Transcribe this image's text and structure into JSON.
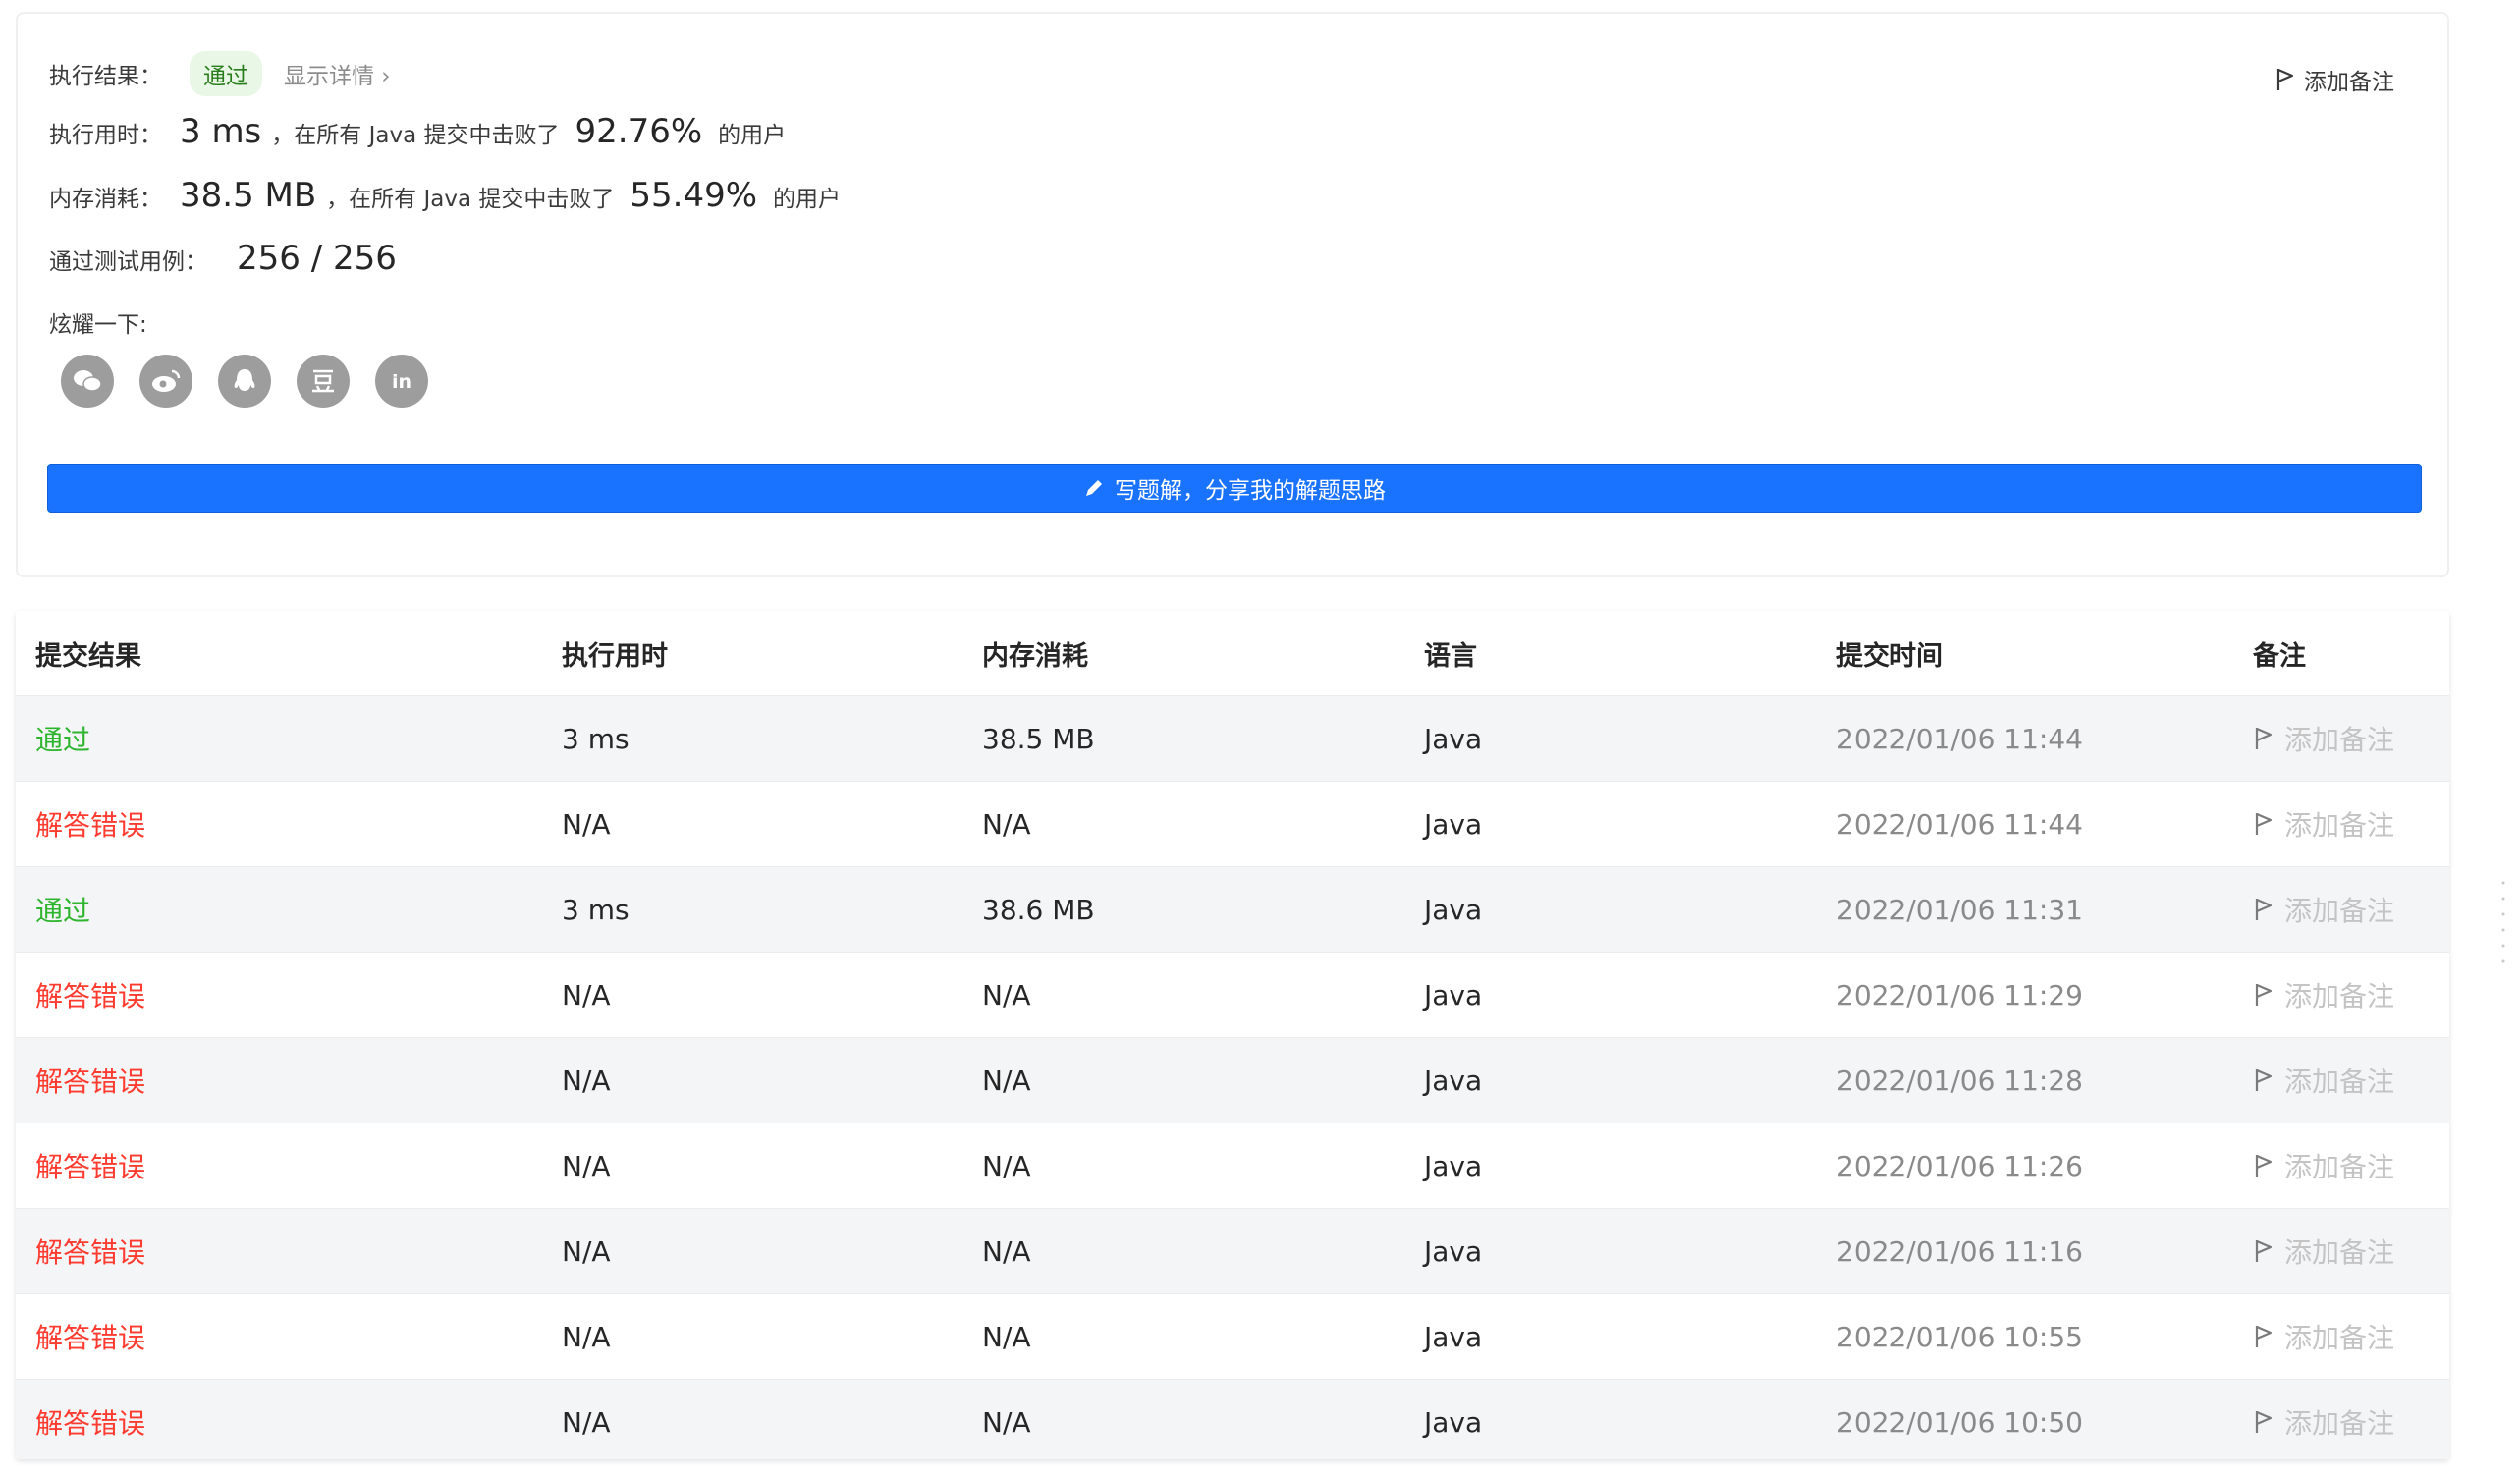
{
  "summary": {
    "result_label": "执行结果：",
    "result_badge": "通过",
    "show_details": "显示详情 ›",
    "add_note": "添加备注",
    "runtime_label": "执行用时：",
    "runtime_value": "3 ms",
    "runtime_text1": "，在所有 Java 提交中击败了",
    "runtime_percent": "92.76%",
    "runtime_text2": "的用户",
    "memory_label": "内存消耗：",
    "memory_value": "38.5 MB",
    "memory_text1": "，在所有 Java 提交中击败了",
    "memory_percent": "55.49%",
    "memory_text2": "的用户",
    "tests_label": "通过测试用例：",
    "tests_value": "256 / 256",
    "share_label": "炫耀一下:",
    "share_icons": [
      "wechat-icon",
      "weibo-icon",
      "qq-icon",
      "douban-icon",
      "linkedin-icon"
    ],
    "cta_label": "写题解，分享我的解题思路"
  },
  "table": {
    "headers": [
      "提交结果",
      "执行用时",
      "内存消耗",
      "语言",
      "提交时间",
      "备注"
    ],
    "rows": [
      {
        "status": "通过",
        "runtime": "3 ms",
        "memory": "38.5 MB",
        "lang": "Java",
        "time": "2022/01/06 11:44",
        "note": "添加备注"
      },
      {
        "status": "解答错误",
        "runtime": "N/A",
        "memory": "N/A",
        "lang": "Java",
        "time": "2022/01/06 11:44",
        "note": "添加备注"
      },
      {
        "status": "通过",
        "runtime": "3 ms",
        "memory": "38.6 MB",
        "lang": "Java",
        "time": "2022/01/06 11:31",
        "note": "添加备注"
      },
      {
        "status": "解答错误",
        "runtime": "N/A",
        "memory": "N/A",
        "lang": "Java",
        "time": "2022/01/06 11:29",
        "note": "添加备注"
      },
      {
        "status": "解答错误",
        "runtime": "N/A",
        "memory": "N/A",
        "lang": "Java",
        "time": "2022/01/06 11:28",
        "note": "添加备注"
      },
      {
        "status": "解答错误",
        "runtime": "N/A",
        "memory": "N/A",
        "lang": "Java",
        "time": "2022/01/06 11:26",
        "note": "添加备注"
      },
      {
        "status": "解答错误",
        "runtime": "N/A",
        "memory": "N/A",
        "lang": "Java",
        "time": "2022/01/06 11:16",
        "note": "添加备注"
      },
      {
        "status": "解答错误",
        "runtime": "N/A",
        "memory": "N/A",
        "lang": "Java",
        "time": "2022/01/06 10:55",
        "note": "添加备注"
      },
      {
        "status": "解答错误",
        "runtime": "N/A",
        "memory": "N/A",
        "lang": "Java",
        "time": "2022/01/06 10:50",
        "note": "添加备注"
      }
    ]
  },
  "colors": {
    "pass": "#2db52d",
    "fail": "#ff3b30",
    "accent": "#1a73ff"
  }
}
